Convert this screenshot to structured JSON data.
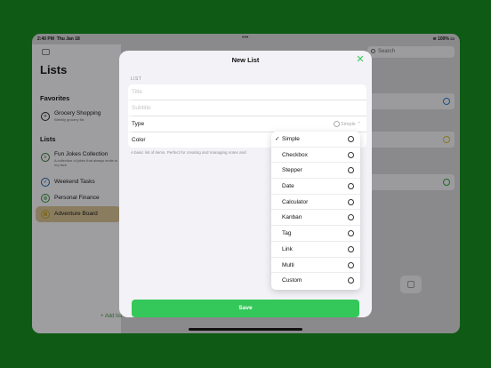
{
  "status_bar": {
    "time": "2:40 PM",
    "date": "Thu Jan 18",
    "battery": "100%"
  },
  "sidebar": {
    "title": "Lists",
    "favorites_heading": "Favorites",
    "favorites": [
      {
        "label": "Grocery Shopping",
        "subtitle": "Weekly grocery list",
        "icon": "add-circle-icon",
        "color": "#1c1c1e"
      }
    ],
    "lists_heading": "Lists",
    "lists": [
      {
        "label": "Fun Jokes Collection",
        "subtitle": "A collection of jokes that always smile to my face",
        "icon": "list-icon",
        "color": "#1f4d22"
      },
      {
        "label": "Weekend Tasks",
        "subtitle": "",
        "icon": "checkmark-circle-icon",
        "color": "#17406b"
      },
      {
        "label": "Personal Finance",
        "subtitle": "",
        "icon": "target-icon",
        "color": "#1f5c22"
      },
      {
        "label": "Adventure Board",
        "subtitle": "",
        "icon": "board-icon",
        "color": "#7d6a1f",
        "selected": true
      }
    ],
    "add_list_label": "+ Add list"
  },
  "search": {
    "placeholder": "Search"
  },
  "modal": {
    "title": "New List",
    "group_label": "LIST",
    "title_placeholder": "Title",
    "subtitle_placeholder": "Subtitle",
    "type_label": "Type",
    "type_value": "Simple",
    "color_label": "Color",
    "description": "A basic list of items. Perfect for creating and managing notes and",
    "save_label": "Save",
    "accent_color": "#34c759"
  },
  "type_menu": {
    "selected": "Simple",
    "options": [
      {
        "label": "Simple",
        "icon": "simple-icon",
        "checked": true
      },
      {
        "label": "Checkbox",
        "icon": "checkbox-icon"
      },
      {
        "label": "Stepper",
        "icon": "stepper-icon"
      },
      {
        "label": "Date",
        "icon": "calendar-icon"
      },
      {
        "label": "Calculator",
        "icon": "calculator-icon"
      },
      {
        "label": "Kanban",
        "icon": "kanban-icon"
      },
      {
        "label": "Tag",
        "icon": "tag-icon"
      },
      {
        "label": "Link",
        "icon": "link-icon"
      },
      {
        "label": "Multi",
        "icon": "multi-icon"
      },
      {
        "label": "Custom",
        "icon": "custom-icon"
      }
    ]
  },
  "right_pane_icon_colors": [
    "#1e4f8a",
    "#8a7a1e",
    "#1f6b2a"
  ]
}
